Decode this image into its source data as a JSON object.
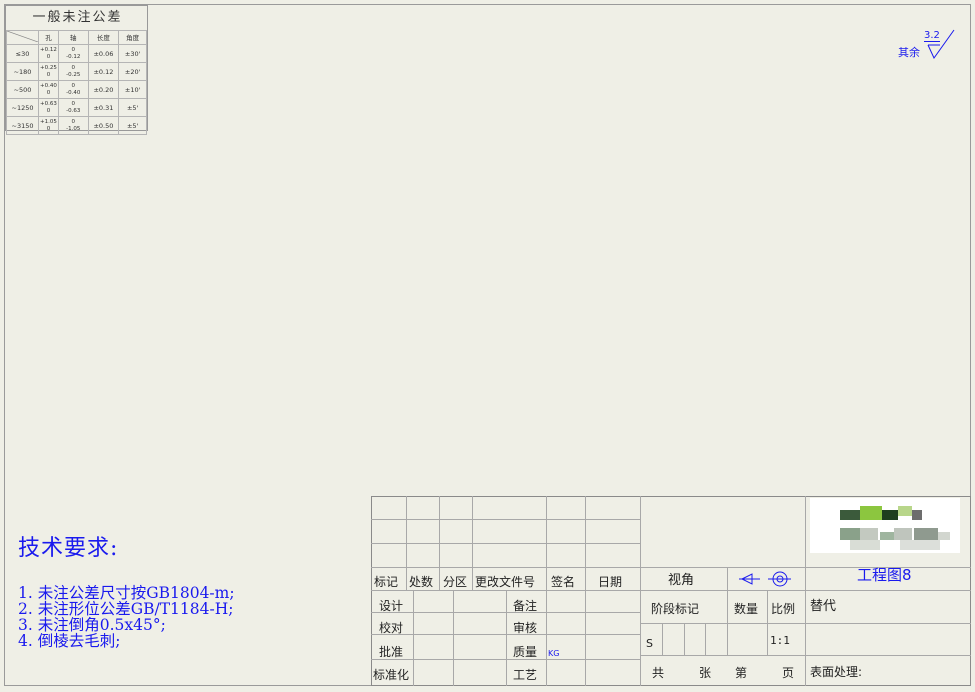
{
  "tolerance_table": {
    "title": "一般未注公差",
    "headers": [
      "孔",
      "轴",
      "长度",
      "角度"
    ],
    "rows": [
      {
        "range": "≤30",
        "hole": [
          "+0.12",
          "0"
        ],
        "shaft": [
          "0",
          "-0.12"
        ],
        "length": "±0.06",
        "angle": "±30'"
      },
      {
        "range": "~180",
        "hole": [
          "+0.25",
          "0"
        ],
        "shaft": [
          "0",
          "-0.25"
        ],
        "length": "±0.12",
        "angle": "±20'"
      },
      {
        "range": "~500",
        "hole": [
          "+0.40",
          "0"
        ],
        "shaft": [
          "0",
          "-0.40"
        ],
        "length": "±0.20",
        "angle": "±10'"
      },
      {
        "range": "~1250",
        "hole": [
          "+0.63",
          "0"
        ],
        "shaft": [
          "0",
          "-0.63"
        ],
        "length": "±0.31",
        "angle": "±5'"
      },
      {
        "range": "~3150",
        "hole": [
          "+1.05",
          "0"
        ],
        "shaft": [
          "0",
          "-1.05"
        ],
        "length": "±0.50",
        "angle": "±5'"
      }
    ]
  },
  "roughness": {
    "label": "其余",
    "value": "3.2"
  },
  "tech_requirements": {
    "title": "技术要求:",
    "items": [
      "1. 未注公差尺寸按GB1804-m;",
      "2. 未注形位公差GB/T1184-H;",
      "3. 未注倒角0.5x45°;",
      "4. 倒棱去毛刺;"
    ]
  },
  "title_block": {
    "rev_headers": [
      "标记",
      "处数",
      "分区",
      "更改文件号",
      "签名",
      "日期"
    ],
    "view_angle": "视角",
    "drawing_name": "工程图8",
    "design": "设计",
    "check": "校对",
    "approve": "批准",
    "standardize": "标准化",
    "remark": "备注",
    "review": "审核",
    "mass": "质量",
    "mass_unit": "KG",
    "process": "工艺",
    "stage_mark": "阶段标记",
    "quantity": "数量",
    "scale_label": "比例",
    "scale_value": "1:1",
    "replace": "替代",
    "stage_s": "S",
    "total": "共",
    "sheets": "张",
    "no": "第",
    "page": "页",
    "surface": "表面处理:"
  }
}
